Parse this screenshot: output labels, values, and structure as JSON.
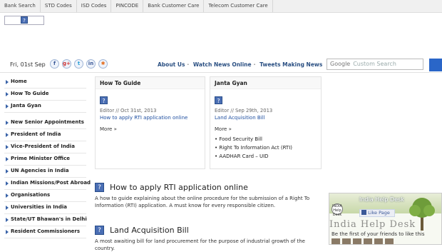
{
  "topnav": [
    "Bank Search",
    "STD Codes",
    "ISD Codes",
    "PINCODE",
    "Bank Customer Care",
    "Telecom Customer Care"
  ],
  "header": {
    "date": "Fri, 01st Sep",
    "links": [
      "About Us",
      "Watch News Online",
      "Tweets Making News"
    ],
    "search_brand": "Google",
    "search_placeholder": "Custom Search"
  },
  "sidebar": {
    "group1": [
      "Home",
      "How To Guide",
      "Janta Gyan"
    ],
    "group2": [
      "New Senior Appointments",
      "President of India",
      "Vice-President of India",
      "Prime Minister Office",
      "UN Agencies in India",
      "Indian Missions/Post Abroad",
      "Organisations",
      "Universities in India",
      "State/UT Bhawan's in Delhi",
      "Resident Commissioners"
    ]
  },
  "boxes": {
    "howto": {
      "head": "How To Guide",
      "meta": "Editor // Oct 31st, 2013",
      "title": "How to apply RTI application online",
      "more": "More »"
    },
    "janta": {
      "head": "Janta Gyan",
      "meta": "Editor // Sep 29th, 2013",
      "title": "Land Acquisition Bill",
      "more": "More »",
      "list": [
        "• Food Security Bill",
        "• Right To Information Act (RTI)",
        "• AADHAR Card – UID"
      ]
    }
  },
  "articles": [
    {
      "title": "How to apply RTI application online",
      "body": "A how to guide explaining about the online procedure for the submission of a Right To Information (RTI) application. A must know for every responsible citizen."
    },
    {
      "title": "Land Acquisition Bill",
      "body": "A most awaiting bill for land procurement for the purpose of industrial growth of the country."
    }
  ],
  "facebook": {
    "page_name": "India Help Desk",
    "logo_text": "INDIA Help Desk",
    "like": "Like Page",
    "watermark": "India Help Desk",
    "friends_text": "Be the first of your friends to like this"
  },
  "colors": {
    "link": "#1f4fa0",
    "nav_accent": "#3a63a8",
    "search_button": "#2a66c8"
  }
}
